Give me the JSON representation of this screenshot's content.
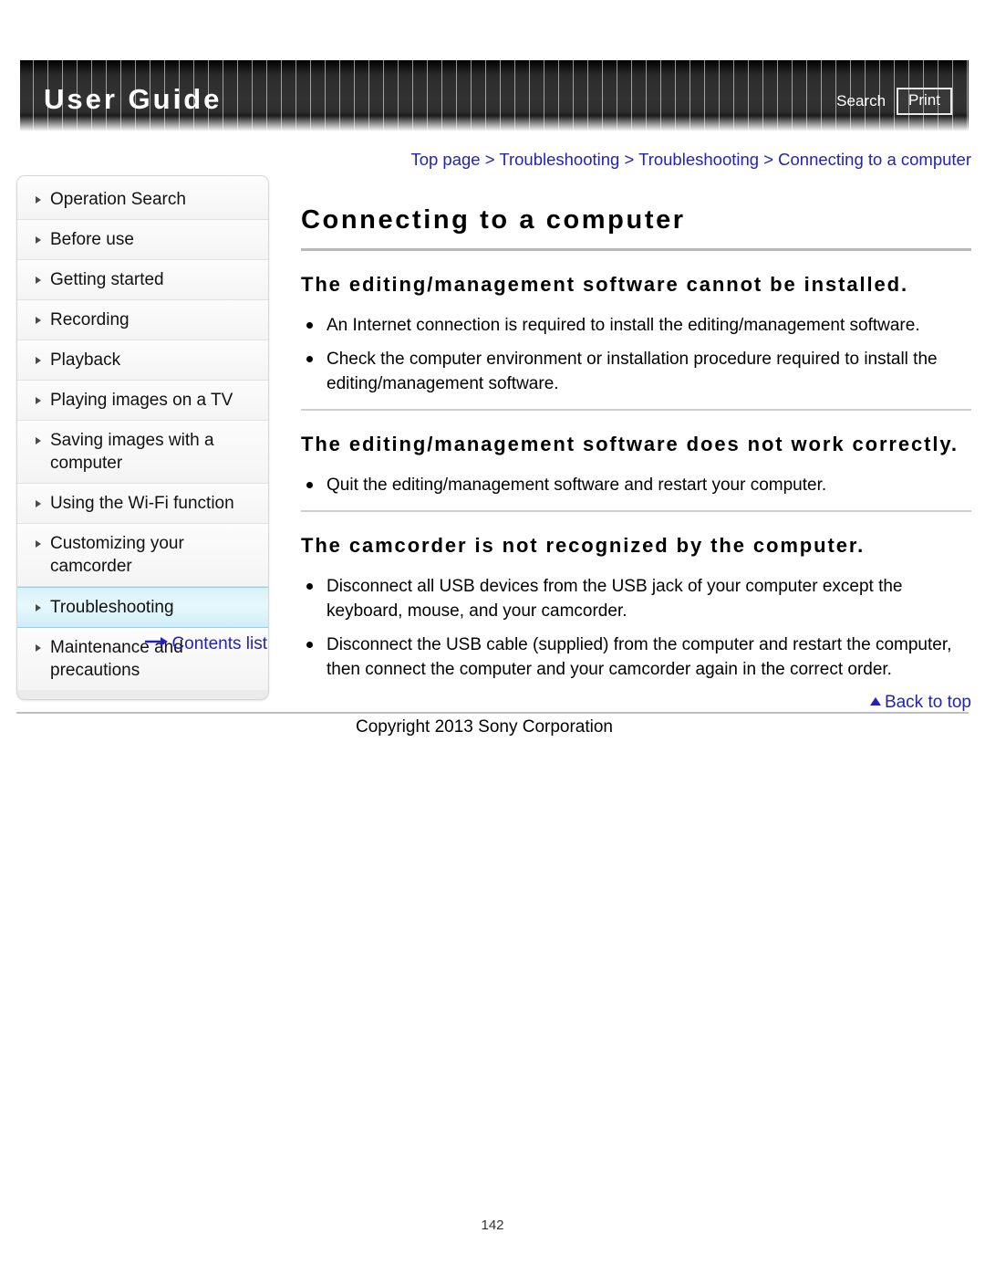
{
  "header": {
    "title": "User Guide",
    "search_label": "Search",
    "print_label": "Print"
  },
  "breadcrumb": {
    "text": "Top page > Troubleshooting > Troubleshooting > Connecting to a computer"
  },
  "sidebar": {
    "items": [
      {
        "label": "Operation Search",
        "active": false
      },
      {
        "label": "Before use",
        "active": false
      },
      {
        "label": "Getting started",
        "active": false
      },
      {
        "label": "Recording",
        "active": false
      },
      {
        "label": "Playback",
        "active": false
      },
      {
        "label": "Playing images on a TV",
        "active": false
      },
      {
        "label": "Saving images with a computer",
        "active": false
      },
      {
        "label": "Using the Wi-Fi function",
        "active": false
      },
      {
        "label": "Customizing your camcorder",
        "active": false
      },
      {
        "label": "Troubleshooting",
        "active": true
      },
      {
        "label": "Maintenance and precautions",
        "active": false
      }
    ],
    "contents_link": "Contents list"
  },
  "main": {
    "title": "Connecting to a computer",
    "sections": [
      {
        "heading": "The editing/management software cannot be installed.",
        "bullets": [
          "An Internet connection is required to install the editing/management software.",
          "Check the computer environment or installation procedure required to install the editing/management software."
        ]
      },
      {
        "heading": "The editing/management software does not work correctly.",
        "bullets": [
          "Quit the editing/management software and restart your computer."
        ]
      },
      {
        "heading": "The camcorder is not recognized by the computer.",
        "bullets": [
          "Disconnect all USB devices from the USB jack of your computer except the keyboard, mouse, and your camcorder.",
          "Disconnect the USB cable (supplied) from the computer and restart the computer, then connect the computer and your camcorder again in the correct order."
        ]
      }
    ],
    "back_to_top": "Back to top"
  },
  "footer": {
    "copyright": "Copyright 2013 Sony Corporation",
    "page_number": "142"
  },
  "colors": {
    "link": "#2222bb",
    "active_nav_bg": "#d5f2f9",
    "active_nav_border": "#8fd4e4",
    "header_dark": "#2c2c2c",
    "rule": "#bfbfbf"
  }
}
